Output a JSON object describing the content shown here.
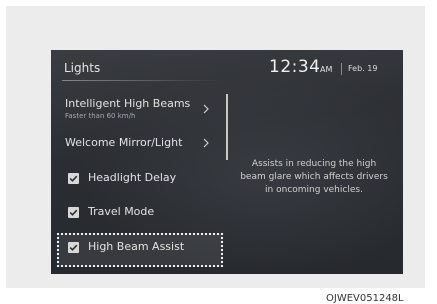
{
  "header": {
    "title": "Lights",
    "time": "12:34",
    "ampm": "AM",
    "date": "Feb. 19"
  },
  "menu": {
    "items": [
      {
        "label": "Intelligent High Beams",
        "sub": "Faster than 60 km/h"
      },
      {
        "label": "Welcome Mirror/Light"
      }
    ],
    "checkboxes": [
      {
        "label": "Headlight Delay",
        "checked": true
      },
      {
        "label": "Travel Mode",
        "checked": true
      },
      {
        "label": "High Beam Assist",
        "checked": true,
        "focused": true
      }
    ]
  },
  "description": "Assists in reducing the high beam glare which affects drivers in oncoming vehicles.",
  "figure_code": "OJWEV051248L",
  "colors": {
    "screen_bg": "#2b2e33",
    "text": "#e2e2e2",
    "checkbox": "#d8d8d8",
    "focus_border": "#f2f2f2"
  }
}
